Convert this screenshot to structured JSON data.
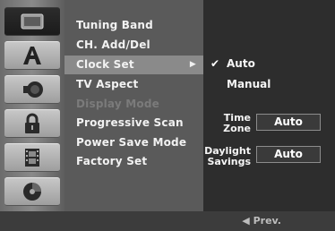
{
  "menu": {
    "items": [
      {
        "label": "Tuning Band"
      },
      {
        "label": "CH. Add/Del"
      },
      {
        "label": "Clock Set"
      },
      {
        "label": "TV Aspect"
      },
      {
        "label": "Display Mode"
      },
      {
        "label": "Progressive Scan"
      },
      {
        "label": "Power Save Mode"
      },
      {
        "label": "Factory Set"
      }
    ],
    "selected_index": 2,
    "disabled_index": 4
  },
  "icons": [
    "setup-monitor",
    "language-A",
    "audio-speaker",
    "lock",
    "film-frames",
    "disc"
  ],
  "panel": {
    "options": [
      {
        "label": "Auto",
        "checked": true
      },
      {
        "label": "Manual",
        "checked": false
      }
    ],
    "time_zone_label_line1": "Time",
    "time_zone_label_line2": "Zone",
    "time_zone_value": "Auto",
    "daylight_label_line1": "Daylight",
    "daylight_label_line2": "Savings",
    "daylight_value": "Auto"
  },
  "footer": {
    "prev_label": "◀ Prev."
  },
  "colors": {
    "menu_bg": "#5a5a5a",
    "menu_selected_bg": "#8a8a8a",
    "panel_bg": "#2d2d2d",
    "disabled_text": "#7b7b7b"
  }
}
